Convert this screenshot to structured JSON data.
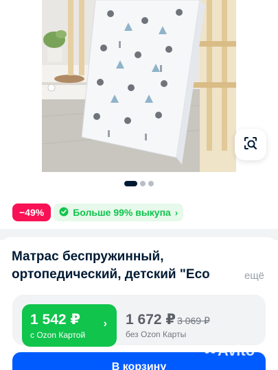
{
  "gallery": {
    "image_alt": "",
    "dots_total": 3,
    "active_dot": 0,
    "visual_search_icon": "image-search-icon"
  },
  "badges": {
    "discount": "−49%",
    "buyout": "Больше 99% выкупа",
    "buyout_icon": "ozon-check-icon",
    "buyout_chevron": "›"
  },
  "product": {
    "title_line1": "Матрас беспружинный,",
    "title_line2": "ортопедический, детский \"Eco",
    "more_label": "ещё"
  },
  "pricing": {
    "ozon_card_price": "1 542 ₽",
    "ozon_card_label": "с Ozon Картой",
    "ozon_card_chevron": "›",
    "regular_price": "1 672 ₽",
    "old_price": "3 069 ₽",
    "regular_label": "без Ozon Карты"
  },
  "actions": {
    "cart_label": "В корзину"
  },
  "watermark": {
    "text": "Avito"
  },
  "colors": {
    "discount_bg": "#f91155",
    "buyout_fg": "#10c44c",
    "ozon_green": "#10c44c",
    "primary_blue": "#005bff",
    "text_dark": "#001a34"
  }
}
